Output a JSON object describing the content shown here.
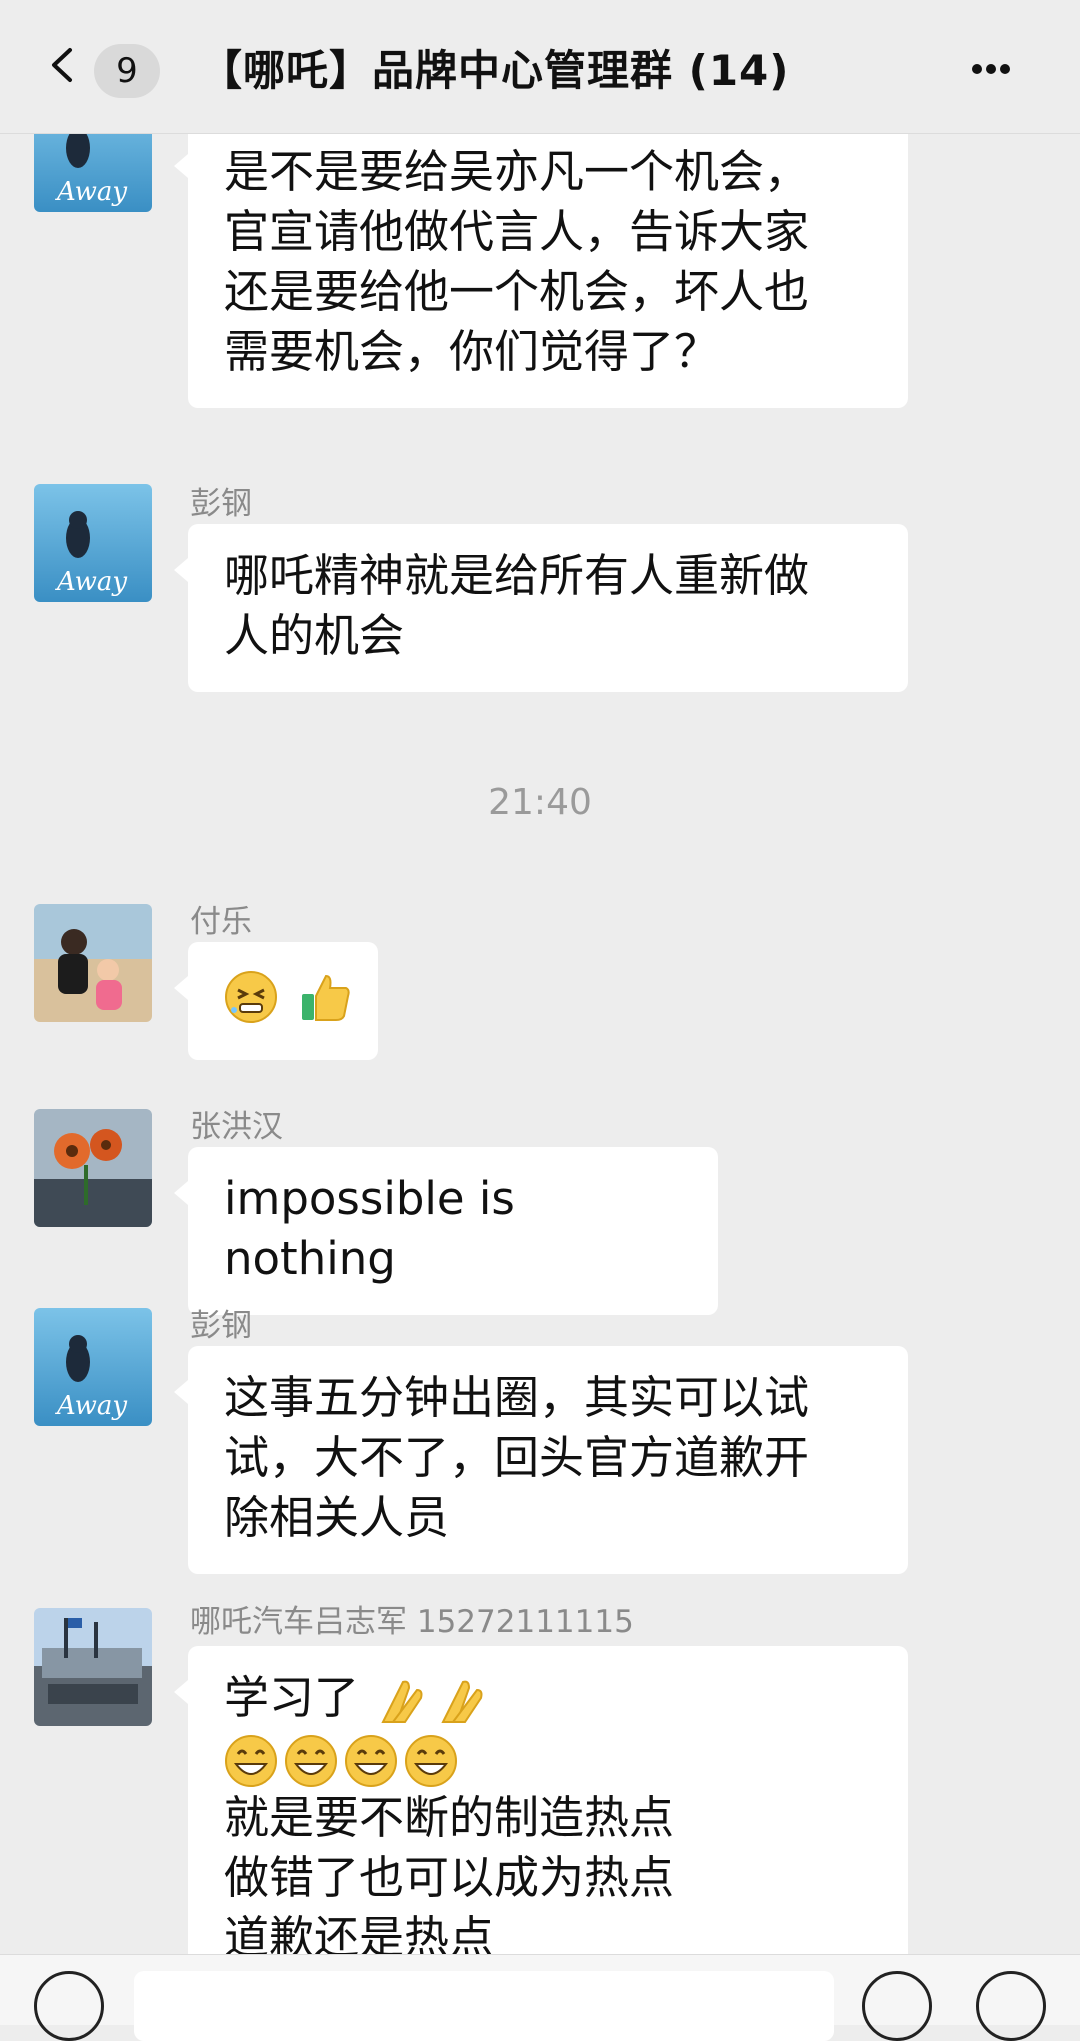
{
  "header": {
    "unread_count": "9",
    "title": "【哪吒】品牌中心管理群 (14)"
  },
  "messages": [
    {
      "sender": "",
      "avatar_icon": "away-avatar-icon",
      "lines": [
        "是不是要给吴亦凡一个机会，",
        "官宣请他做代言人，告诉大家",
        "还是要给他一个机会，坏人也",
        "需要机会，你们觉得了？"
      ]
    },
    {
      "sender": "彭钢",
      "avatar_icon": "away-avatar-icon",
      "lines": [
        "哪吒精神就是给所有人重新做",
        "人的机会"
      ]
    },
    {
      "timestamp": "21:40"
    },
    {
      "sender": "付乐",
      "avatar_icon": "beach-photo-avatar-icon",
      "emojis": [
        "grimace-emoji-icon",
        "thumbs-up-emoji-icon"
      ]
    },
    {
      "sender": "张洪汉",
      "avatar_icon": "flower-photo-avatar-icon",
      "lines": [
        "impossible is nothing"
      ]
    },
    {
      "sender": "彭钢",
      "avatar_icon": "away-avatar-icon",
      "lines": [
        "这事五分钟出圈，其实可以试",
        "试，大不了，回头官方道歉开",
        "除相关人员"
      ]
    },
    {
      "sender": "哪吒汽车吕志军 15272111115",
      "avatar_icon": "building-photo-avatar-icon",
      "line1_text": "学习了",
      "line1_emojis": [
        "clap-hands-emoji-icon",
        "clap-hands-emoji-icon"
      ],
      "line2_emojis": [
        "grin-emoji-icon",
        "grin-emoji-icon",
        "grin-emoji-icon",
        "grin-emoji-icon"
      ],
      "lines": [
        "就是要不断的制造热点",
        "做错了也可以成为热点",
        "道歉还是热点"
      ]
    }
  ],
  "away_label": "Away",
  "colors": {
    "background": "#ededed",
    "bubble": "#ffffff",
    "meta_text": "#8a8a8a",
    "timestamp_text": "#9a9a9a"
  }
}
